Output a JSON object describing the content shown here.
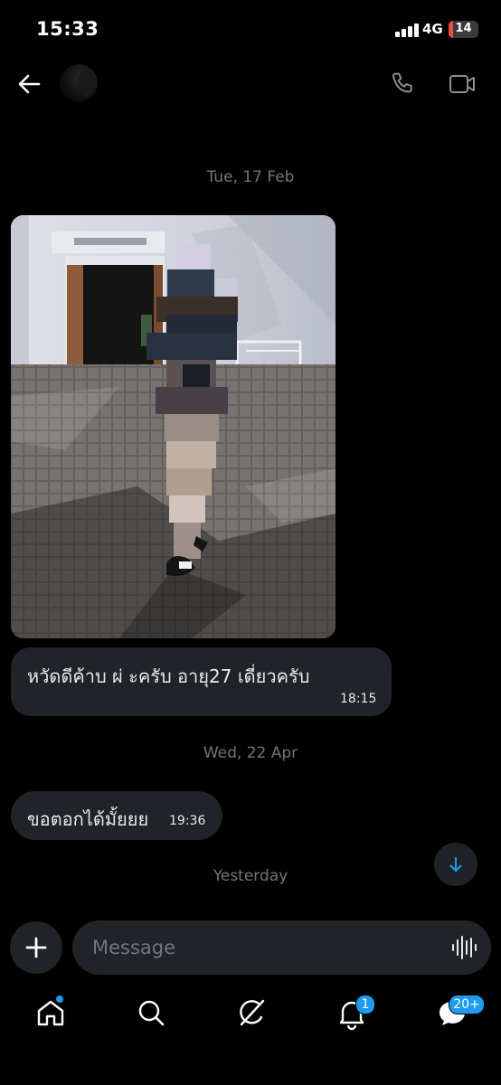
{
  "status_bar": {
    "time": "15:33",
    "network": "4G",
    "battery": "14",
    "battery_fraction": 0.14
  },
  "header": {
    "back_icon": "arrow-left-icon",
    "call_icon": "phone-icon",
    "video_icon": "video-camera-icon"
  },
  "messages": {
    "date_1": "Tue, 17 Feb",
    "msg_1_text": "หวัดดีค้าบ ผ่          ะครับ อายุ27 เดี่ยวครับ",
    "msg_1_time": "18:15",
    "date_2": "Wed, 22 Apr",
    "msg_2_text": "ขอตอกได้มั้ยยย",
    "msg_2_time": "19:36",
    "date_3": "Yesterday"
  },
  "composer": {
    "placeholder": "Message",
    "add_icon": "plus-icon",
    "voice_icon": "waveform-icon"
  },
  "nav": {
    "items": [
      "home-icon",
      "search-icon",
      "grok-icon",
      "bell-icon",
      "messages-icon"
    ],
    "notifications_badge": "1",
    "messages_badge": "20+"
  },
  "colors": {
    "accent": "#1d9bf0",
    "bubble": "#202327",
    "muted": "#71767b",
    "battery_low": "#eb4e3d"
  }
}
